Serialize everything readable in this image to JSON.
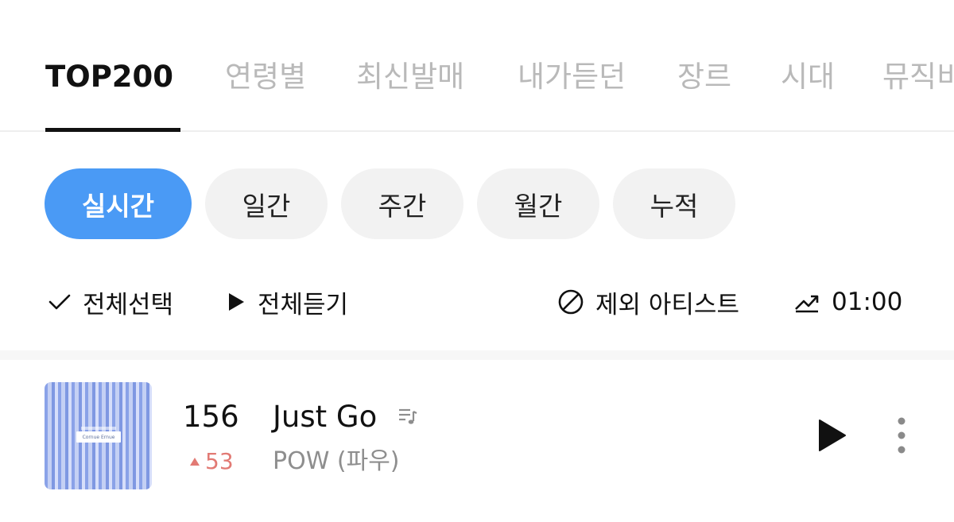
{
  "tabs": [
    {
      "label": "TOP200",
      "active": true
    },
    {
      "label": "연령별"
    },
    {
      "label": "최신발매"
    },
    {
      "label": "내가듣던"
    },
    {
      "label": "장르"
    },
    {
      "label": "시대"
    },
    {
      "label": "뮤직비"
    }
  ],
  "periods": [
    {
      "label": "실시간",
      "active": true
    },
    {
      "label": "일간"
    },
    {
      "label": "주간"
    },
    {
      "label": "월간"
    },
    {
      "label": "누적"
    }
  ],
  "toolbar": {
    "select_all": "전체선택",
    "play_all": "전체듣기",
    "exclude_artist": "제외 아티스트",
    "time": "01:00"
  },
  "track": {
    "rank": "156",
    "rank_change": "53",
    "rank_direction": "up",
    "title": "Just Go",
    "artist": "POW (파우)",
    "cover_text": "Cornue Ernue"
  },
  "colors": {
    "accent": "#4a9af5",
    "rank_up": "#e27a74",
    "inactive_tab": "#b9b9b9"
  }
}
